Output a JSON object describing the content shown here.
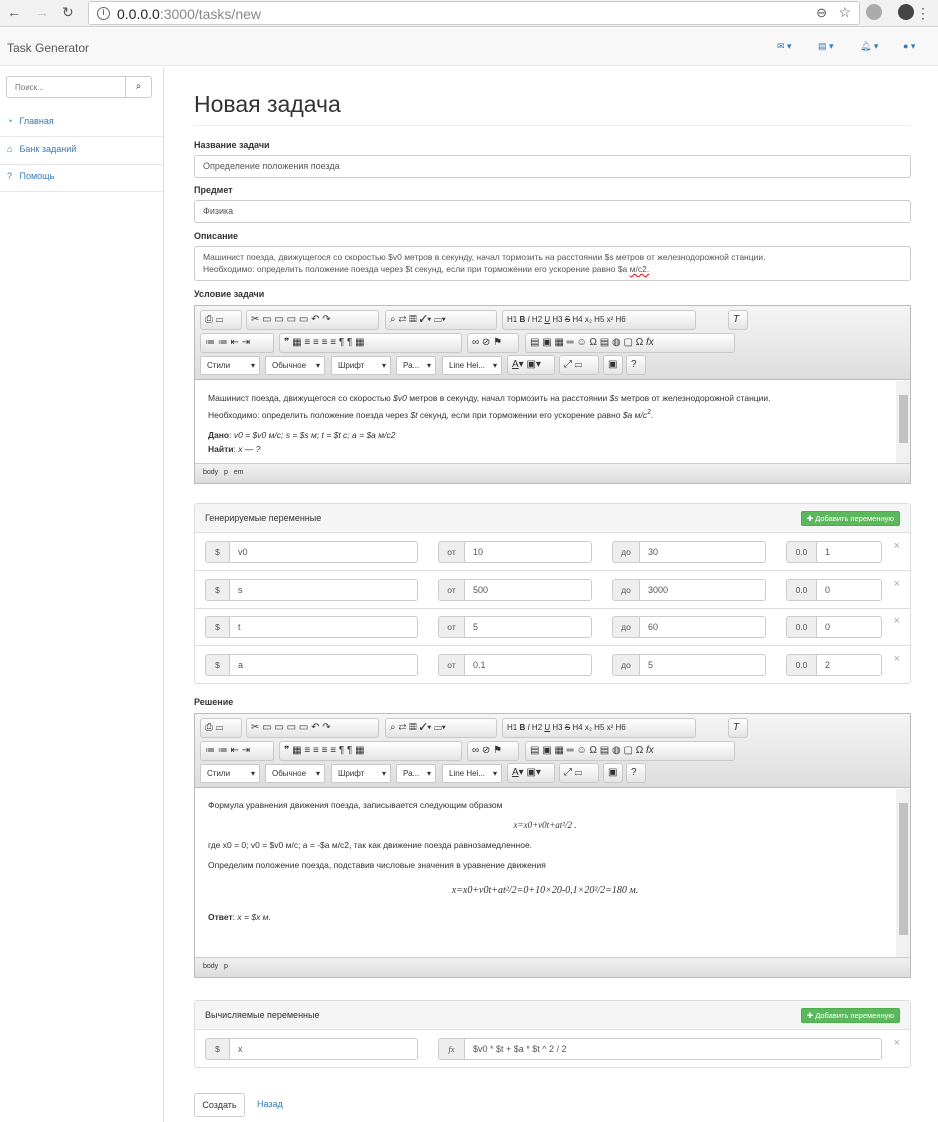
{
  "browser": {
    "url_host": "0.0.0.0",
    "url_rest": ":3000/tasks/new"
  },
  "navbar": {
    "brand": "Task Generator",
    "icons": [
      "envelope-icon",
      "tasks-icon",
      "bell-icon",
      "user-icon"
    ]
  },
  "sidebar": {
    "search_placeholder": "Поиск...",
    "items": [
      {
        "label": "Главная",
        "icon": "dashboard-icon"
      },
      {
        "label": "Банк заданий",
        "icon": "bank-icon"
      },
      {
        "label": "Помощь",
        "icon": "question-icon"
      }
    ]
  },
  "page": {
    "title": "Новая задача"
  },
  "form": {
    "name_label": "Название задачи",
    "name_value": "Определение положения поезда",
    "subject_label": "Предмет",
    "subject_value": "Физика",
    "desc_label": "Описание",
    "desc_line1": "Машинист поезда, движущегося со скоростью $v0 метров в секунду, начал тормозить на расстоянии $s метров от железнодорожной станции.",
    "desc_line2": "Необходимо: определить положение поезда через $t секунд, если при торможении его ускорение равно $a ",
    "desc_line2_tail": "м/с2.",
    "condition_label": "Условие задачи",
    "solution_label": "Решение"
  },
  "toolbar": {
    "styles": "Стили",
    "format": "Обычное",
    "font": "Шрифт",
    "size": "Ра...",
    "lineheight": "Line Hei..."
  },
  "condition": {
    "p1": "Машинист поезда, движущегося со скоростью ",
    "p1v": "$v0",
    "p1b": " метров в секунду, начал тормозить на расстоянии ",
    "p1s": "$s",
    "p1c": " метров от железнодорожной станции.",
    "p2": "Необходимо: определить положение поезда через ",
    "p2t": "$t",
    "p2b": " секунд, если при торможении его ускорение равно ",
    "p2a": "$a м/с",
    "given_label": "Дано",
    "given": "v0 = $v0 м/с; s = $s м; t = $t с; a = $a м/с2",
    "find_label": "Найти",
    "find": "x — ?",
    "path": [
      "body",
      "p",
      "em"
    ]
  },
  "gen_vars": {
    "title": "Генерируемые переменные",
    "add_label": "Добавить переменную",
    "from_label": "от",
    "to_label": "до",
    "prec_label": "0.0",
    "dollar": "$",
    "rows": [
      {
        "name": "v0",
        "from": "10",
        "to": "30",
        "prec": "1"
      },
      {
        "name": "s",
        "from": "500",
        "to": "3000",
        "prec": "0"
      },
      {
        "name": "t",
        "from": "5",
        "to": "60",
        "prec": "0"
      },
      {
        "name": "a",
        "from": "0.1",
        "to": "5",
        "prec": "2"
      }
    ]
  },
  "solution": {
    "p1": "Формула уравнения движения поезда, записывается следующим образом",
    "f1": "x=x0+v0t+at²/2 .",
    "p2": "где x0 = 0; v0 = $v0 м/с; a = -$a м/с2, так как движение поезда равнозамедленное.",
    "p3": "Определим положение поезда, подставив числовые значения в уравнение движения",
    "f2": "x=x0+v0t+at²/2=0+10×20-0,1×20²/2=180 м.",
    "answer_label": "Ответ",
    "answer": "x = $x м.",
    "path": [
      "body",
      "p"
    ]
  },
  "calc_vars": {
    "title": "Вычисляемые переменные",
    "add_label": "Добавить переменную",
    "dollar": "$",
    "fx": "fx",
    "name": "x",
    "formula": "$v0 * $t + $a * $t ^ 2 / 2"
  },
  "actions": {
    "create": "Создать",
    "back": "Назад"
  }
}
